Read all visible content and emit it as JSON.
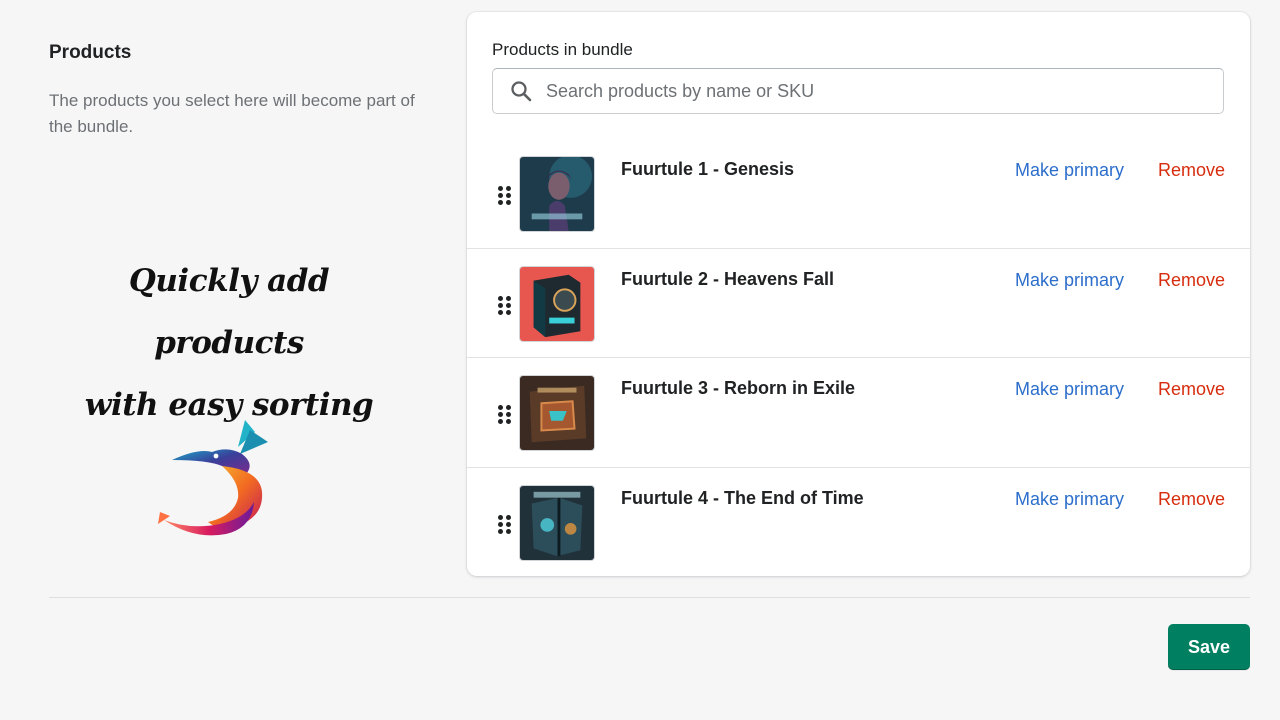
{
  "section": {
    "title": "Products",
    "description": "The products you select here will become part of the bundle."
  },
  "promo": {
    "line1": "Quickly add products",
    "line2": "with easy sorting"
  },
  "card": {
    "label": "Products in bundle",
    "search_placeholder": "Search products by name or SKU"
  },
  "products": [
    {
      "name": "Fuurtule 1 - Genesis",
      "make_primary": "Make primary",
      "remove": "Remove"
    },
    {
      "name": "Fuurtule 2 - Heavens Fall",
      "make_primary": "Make primary",
      "remove": "Remove"
    },
    {
      "name": "Fuurtule 3 - Reborn in Exile",
      "make_primary": "Make primary",
      "remove": "Remove"
    },
    {
      "name": "Fuurtule 4 - The End of Time",
      "make_primary": "Make primary",
      "remove": "Remove"
    }
  ],
  "footer": {
    "save_label": "Save"
  },
  "icons": {
    "search": "search-icon",
    "drag": "drag-handle-icon",
    "logo": "hummingbird-logo"
  },
  "colors": {
    "primary_button": "#008060",
    "link": "#2c6ecb",
    "destructive": "#d72c0d",
    "background": "#f6f6f7"
  }
}
